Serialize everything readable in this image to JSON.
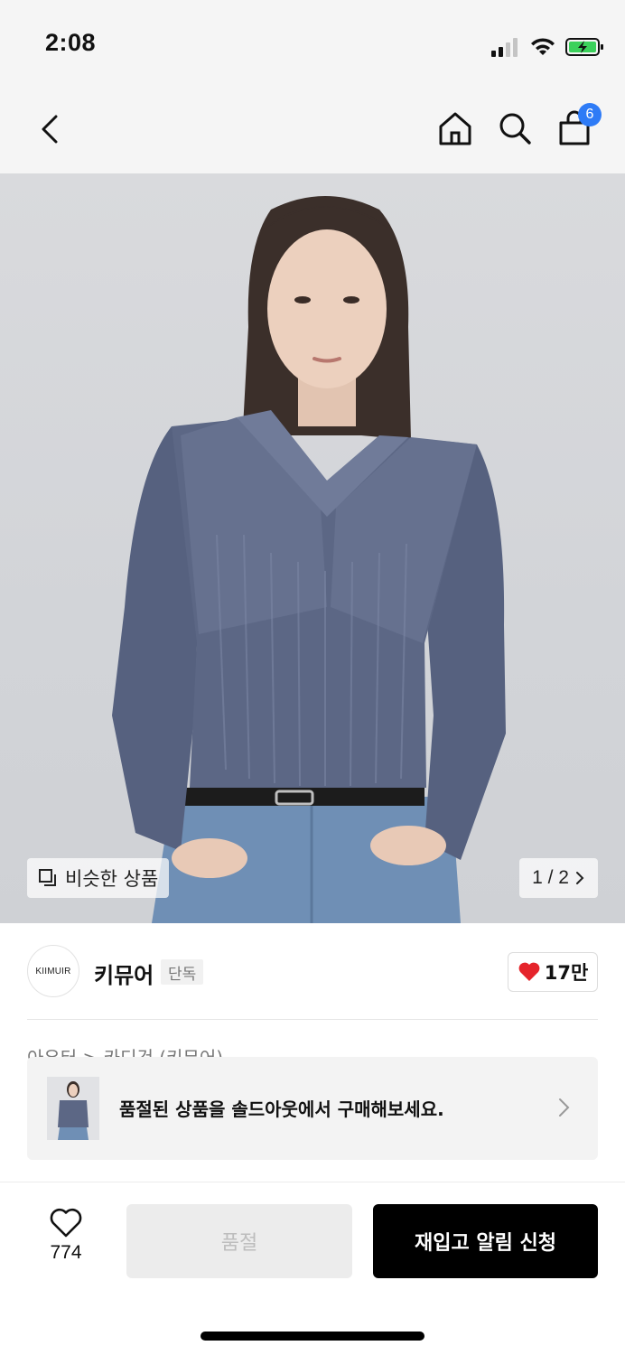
{
  "status_bar": {
    "time": "2:08"
  },
  "nav": {
    "back": "back",
    "cart_count": "6"
  },
  "gallery": {
    "similar_label": "비슷한 상품",
    "page_indicator": "1 / 2"
  },
  "brand": {
    "logo_text": "KIIMUIR",
    "name": "키뮤어",
    "badge": "단독",
    "like_count": "17만"
  },
  "breadcrumb": "아우터 > 카디건 (키뮤어)",
  "soldout_banner": {
    "message": "품절된 상품을 솔드아웃에서 구매해보세요."
  },
  "bottom_bar": {
    "wish_count": "774",
    "soldout_label": "품절",
    "restock_label": "재입고 알림 신청"
  },
  "colors": {
    "accent_blue": "#2e7bf6",
    "heart_red": "#e5242b",
    "sweater": "#5c6785",
    "denim": "#6f8fb5"
  }
}
